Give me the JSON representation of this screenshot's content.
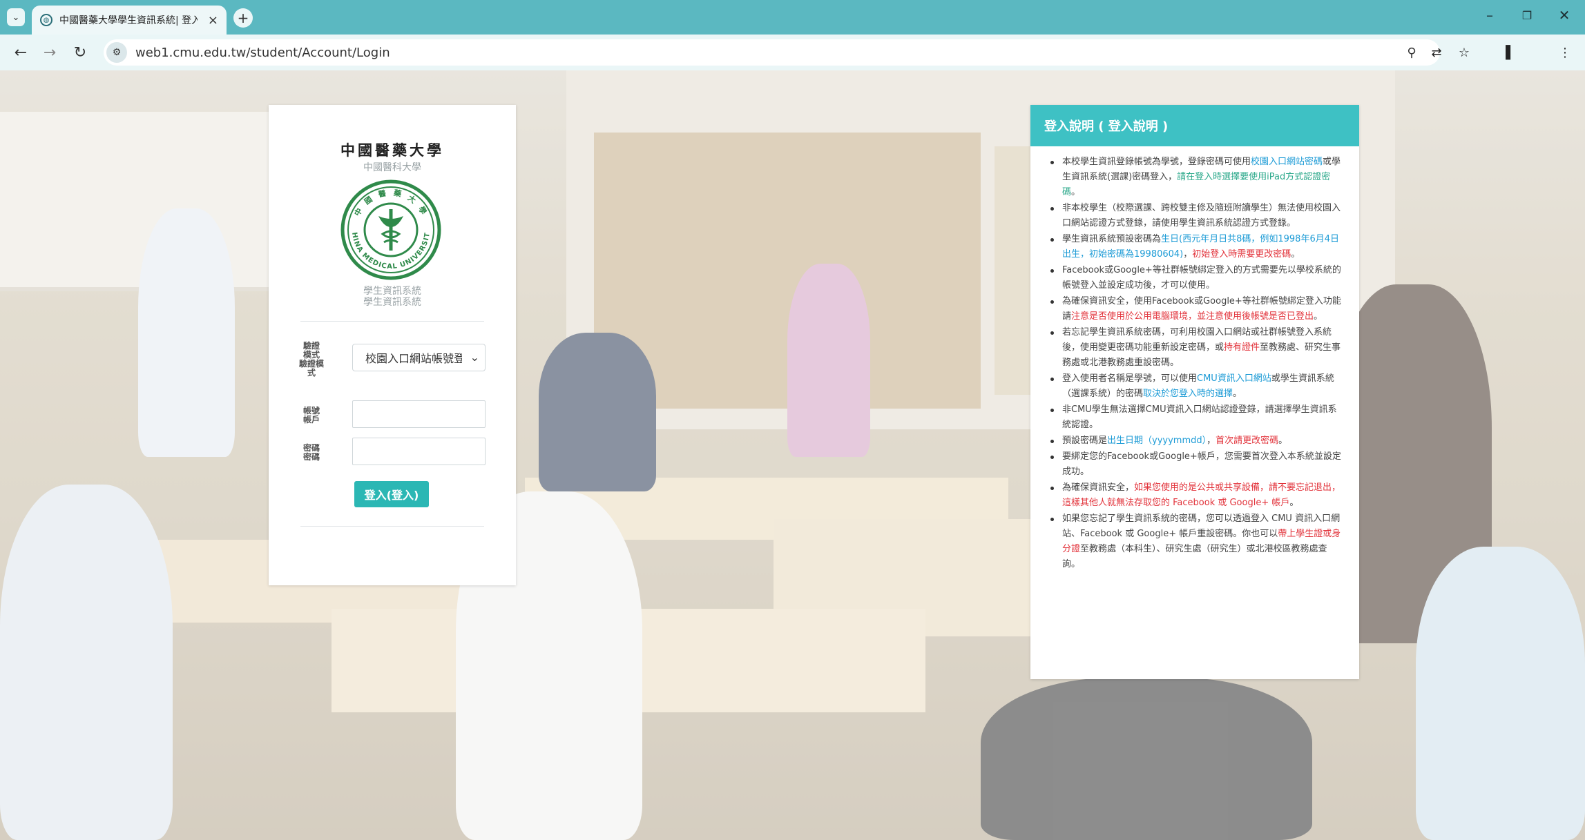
{
  "browser": {
    "tab_title": "中國醫藥大學學生資訊系統| 登入",
    "url": "web1.cmu.edu.tw/student/Account/Login",
    "icons": {
      "tab_menu": "chevron-down-icon",
      "favicon": "globe-icon",
      "tab_close": "close-icon",
      "new_tab": "plus-icon",
      "back": "arrow-left-icon",
      "forward": "arrow-right-icon",
      "reload": "reload-icon",
      "site_info": "tune-icon",
      "search": "search-icon",
      "translate": "translate-icon",
      "bookmark": "star-icon",
      "side_panel": "side-panel-icon",
      "menu": "kebab-menu-icon",
      "minimize": "minimize-icon",
      "maximize": "restore-icon",
      "close_window": "close-icon"
    }
  },
  "login": {
    "university_name": "中國醫藥大學",
    "university_subtitle": "中國醫科大學",
    "seal_text_top": "中 國 醫 藥 大 學",
    "seal_text_bottom": "CHINA MEDICAL UNIVERSITY",
    "system_name_1": "學生資訊系統",
    "system_name_2": "學生資訊系統",
    "mode_label_1": "驗證",
    "mode_label_2": "模式",
    "mode_label_3": "驗證模",
    "mode_label_4": "式",
    "mode_selected": "校園入口網站帳號登入",
    "account_label_1": "帳號",
    "account_label_2": "帳戶",
    "password_label_1": "密碼",
    "password_label_2": "密碼",
    "account_value": "",
    "password_value": "",
    "login_button": "登入(登入)"
  },
  "info": {
    "title": "登入說明 ( 登入說明 )",
    "items": [
      {
        "parts": [
          {
            "text": "本校學生資訊登錄帳號為學號，登錄密碼可使用",
            "color": "normal"
          },
          {
            "text": "校園入口網站密碼",
            "color": "blue"
          },
          {
            "text": "或學生資訊系統(選課)密碼登入，",
            "color": "normal"
          },
          {
            "text": "請在登入時選擇要使用iPad方式認證密碼",
            "color": "green"
          },
          {
            "text": "。",
            "color": "normal"
          }
        ]
      },
      {
        "parts": [
          {
            "text": "非本校學生（校際選課、跨校雙主修及隨班附讀學生）無法使用校園入口網站認證方式登錄，請使用學生資訊系統認證方式登錄。",
            "color": "normal"
          }
        ]
      },
      {
        "parts": [
          {
            "text": "學生資訊系統預設密碼為",
            "color": "normal"
          },
          {
            "text": "生日(西元年月日共8碼，例如1998年6月4日出生，初始密碼為19980604)",
            "color": "blue"
          },
          {
            "text": "，",
            "color": "normal"
          },
          {
            "text": "初始登入時需要更改密碼",
            "color": "red"
          },
          {
            "text": "。",
            "color": "normal"
          }
        ]
      },
      {
        "parts": [
          {
            "text": "Facebook或Google+等社群帳號綁定登入的方式需要先以學校系統的帳號登入並設定成功後，才可以使用。",
            "color": "normal"
          }
        ]
      },
      {
        "parts": [
          {
            "text": "為確保資訊安全，使用Facebook或Google+等社群帳號綁定登入功能請",
            "color": "normal"
          },
          {
            "text": "注意是否使用於公用電腦環境，並注意使用後帳號是否已登出",
            "color": "red"
          },
          {
            "text": "。",
            "color": "normal"
          }
        ]
      },
      {
        "parts": [
          {
            "text": "若忘記學生資訊系統密碼，可利用校園入口網站或社群帳號登入系統後，使用變更密碼功能重新設定密碼，或",
            "color": "normal"
          },
          {
            "text": "持有證件",
            "color": "red"
          },
          {
            "text": "至教務處、研究生事務處或北港教務處重設密碼。",
            "color": "normal"
          }
        ]
      },
      {
        "parts": [
          {
            "text": "登入使用者名稱是學號，可以使用",
            "color": "normal"
          },
          {
            "text": "CMU資訊入口網站",
            "color": "blue"
          },
          {
            "text": "或學生資訊系統（選課系統）的密碼",
            "color": "normal"
          },
          {
            "text": "取決於您登入時的選擇",
            "color": "blue"
          },
          {
            "text": "。",
            "color": "normal"
          }
        ]
      },
      {
        "parts": [
          {
            "text": "非CMU學生無法選擇CMU資訊入口網站認證登錄，請選擇學生資訊系統認證。",
            "color": "normal"
          }
        ]
      },
      {
        "parts": [
          {
            "text": "預設密碼是",
            "color": "normal"
          },
          {
            "text": "出生日期（yyyymmdd）",
            "color": "blue"
          },
          {
            "text": "，",
            "color": "normal"
          },
          {
            "text": "首次請更改密碼",
            "color": "red"
          },
          {
            "text": "。",
            "color": "normal"
          }
        ]
      },
      {
        "parts": [
          {
            "text": "要綁定您的Facebook或Google+帳戶，您需要首次登入本系統並設定成功。",
            "color": "normal"
          }
        ]
      },
      {
        "parts": [
          {
            "text": "為確保資訊安全，",
            "color": "normal"
          },
          {
            "text": "如果您使用的是公共或共享設備，請不要忘記退出，這樣其他人就無法存取您的 Facebook 或 Google+ 帳戶",
            "color": "red"
          },
          {
            "text": "。",
            "color": "normal"
          }
        ]
      },
      {
        "parts": [
          {
            "text": "如果您忘記了學生資訊系統的密碼，您可以透過登入 CMU 資訊入口網站、Facebook 或 Google+ 帳戶重設密碼。你也可以",
            "color": "normal"
          },
          {
            "text": "帶上學生證或身分證",
            "color": "red"
          },
          {
            "text": "至教務處（本科生）、研究生處（研究生）或北港校區教務處查詢。",
            "color": "normal"
          }
        ]
      }
    ]
  },
  "colors": {
    "tabbar": "#5bb8c1",
    "toolbar": "#eaf6f7",
    "accent": "#2bb7b4",
    "info_header": "#3ec1c4",
    "link_blue": "#1c9bd6",
    "warning_red": "#e2323a",
    "note_green": "#2aa88a"
  }
}
